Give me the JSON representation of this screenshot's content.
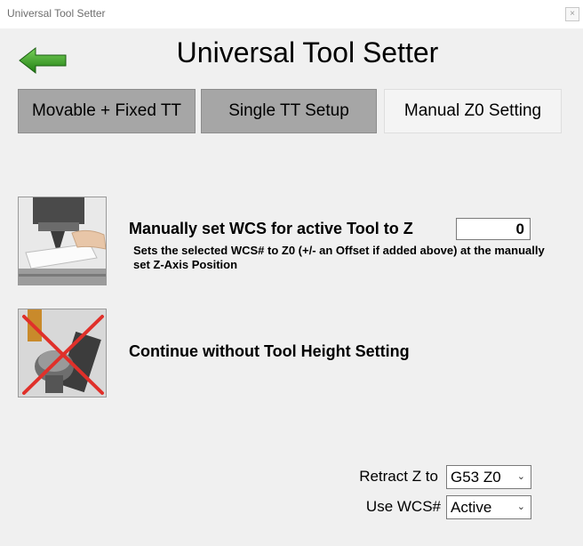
{
  "window": {
    "title": "Universal Tool Setter",
    "close_glyph": "×"
  },
  "header": {
    "title": "Universal Tool Setter",
    "back_icon": "green-left-arrow-icon"
  },
  "tabs": [
    {
      "label": "Movable + Fixed TT",
      "active": false
    },
    {
      "label": "Single TT Setup",
      "active": false
    },
    {
      "label": "Manual Z0 Setting",
      "active": true
    }
  ],
  "options": {
    "manual": {
      "label": "Manually set WCS for active Tool to Z",
      "value": "0",
      "description": "Sets the selected WCS# to Z0 (+/- an Offset if added above) at the manually set Z-Axis Position",
      "image": "manual-touch-off-photo"
    },
    "skip": {
      "label": "Continue without Tool Height Setting",
      "image": "crossed-out-tool-setter-photo"
    }
  },
  "form": {
    "retract_label": "Retract Z to",
    "retract_value": "G53 Z0",
    "wcs_label": "Use WCS#",
    "wcs_value": "Active",
    "chevron": "⌄"
  },
  "colors": {
    "arrow_green": "#2e9b1f",
    "tab_inactive": "#a6a6a6",
    "cross_red": "#e0302a"
  }
}
